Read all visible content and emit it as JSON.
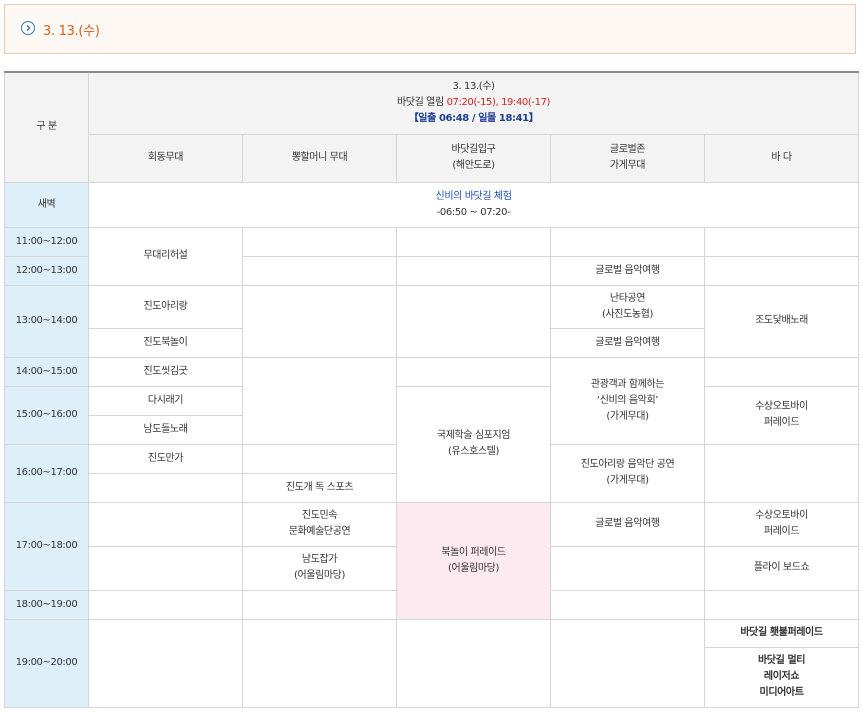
{
  "date_box": {
    "label": "3. 13.(수)"
  },
  "header": {
    "category": "구 분",
    "date": "3. 13.(수)",
    "tide_prefix": "바닷길 열림 ",
    "tide_times": "07:20(-15), 19:40(-17)",
    "sun": "【일출 06:48 / 일몰 18:41】",
    "columns": [
      "회동무대",
      "뽕할머니 무대",
      [
        "바닷길입구",
        "(해안도로)"
      ],
      [
        "글로벌존",
        "가게무대"
      ],
      "바 다"
    ]
  },
  "dawn": {
    "label": "새벽",
    "title": "신비의 바닷길 체험",
    "time": "-06:50 ~ 07:20-"
  },
  "times": [
    "11:00~12:00",
    "12:00~13:00",
    "13:00~14:00",
    "14:00~15:00",
    "15:00~16:00",
    "16:00~17:00",
    "17:00~18:00",
    "18:00~19:00",
    "19:00~20:00"
  ],
  "events": {
    "stage_rehearsal": "무대리허설",
    "global_music_1": "글로벌 음악여행",
    "arirang": "진도아리랑",
    "nanta": [
      "난타공연",
      "(사진도농협)"
    ],
    "jodo": "조도닻배노래",
    "bukkori": "진도북놀이",
    "global_music_2": "글로벌 음악여행",
    "ssitgimgut": "진도씻김굿",
    "concert": [
      "관광객과 함께하는",
      "‘신비의 음악회’",
      "(가게무대)"
    ],
    "dasiraegi": "다시래기",
    "symposium": [
      "국제학술 심포지엄",
      "(유스호스텔)"
    ],
    "waterbike_1": [
      "수상오토바이",
      "퍼레이드"
    ],
    "namdo_deul": "남도들노래",
    "manga": "진도만가",
    "arirang_band": [
      "진도아리랑 음악단 공연",
      "(가게무대)"
    ],
    "jindo_dog": "진도개 독 스포츠",
    "folk_art": [
      "진도민속",
      "문화예술단공연"
    ],
    "drum_parade": [
      "북놀이 퍼레이드",
      "(어울림마당)"
    ],
    "global_music_3": "글로벌 음악여행",
    "waterbike_2": [
      "수상오토바이",
      "퍼레이드"
    ],
    "namdo_japga": [
      "남도잡가",
      "(어울림마당)"
    ],
    "flyboard": "플라이 보드쇼",
    "torch_parade": "바닷길 횃불퍼레이드",
    "multimedia": [
      "바닷길 멀티",
      "레이저쇼",
      "미디어아트"
    ]
  }
}
